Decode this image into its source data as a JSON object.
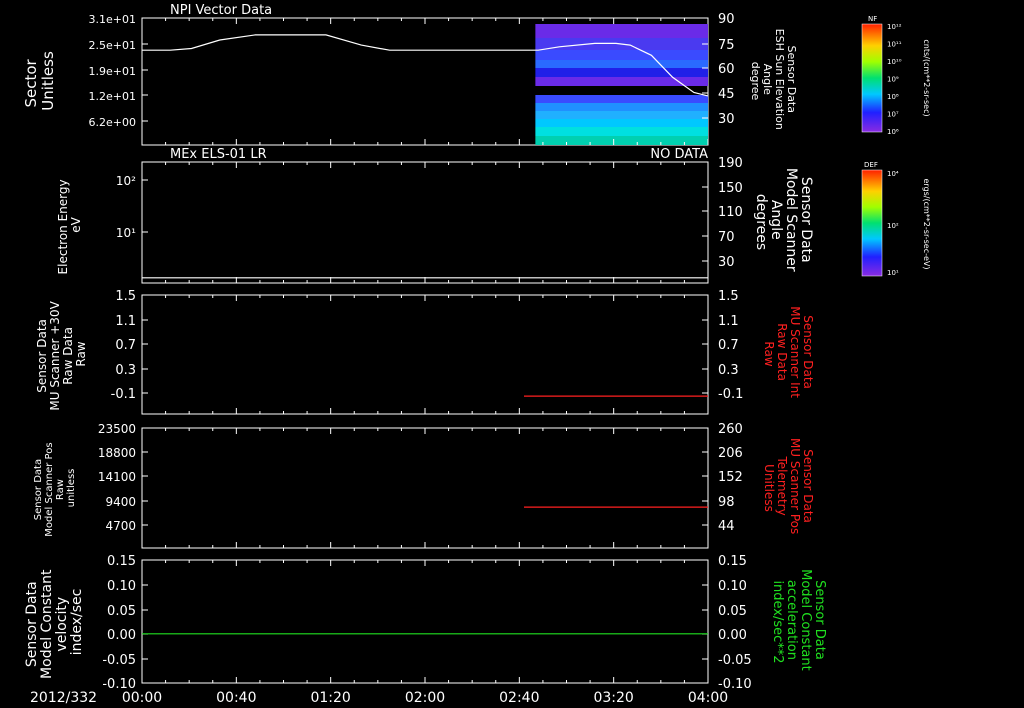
{
  "colors": {
    "background": "#000000",
    "axis": "#ffffff",
    "red": "#ff2020",
    "green": "#20e020"
  },
  "date_label": "2012/332",
  "time_ticks": [
    "00:00",
    "00:40",
    "01:20",
    "02:00",
    "02:40",
    "03:20",
    "04:00"
  ],
  "panel1": {
    "title": "NPI Vector Data",
    "left_label": [
      "Sector",
      "Unitless"
    ],
    "left_ticks": [
      "3.1e+01",
      "2.5e+01",
      "1.9e+01",
      "1.2e+01",
      "6.2e+00"
    ],
    "right_label": [
      "Sensor Data",
      "ESH Sun Elevation",
      "Angle",
      "degree"
    ],
    "right_ticks": [
      "90",
      "75",
      "60",
      "45",
      "30"
    ],
    "colorbar_title": "NF",
    "colorbar_units": "cnts/(cm**2-sr-sec)",
    "colorbar_ticks": [
      "10¹²",
      "10¹¹",
      "10¹⁰",
      "10⁹",
      "10⁸",
      "10⁷",
      "10⁶"
    ]
  },
  "panel2": {
    "title": "MEx ELS-01 LR",
    "status": "NO DATA",
    "left_label": [
      "Electron Energy",
      "eV"
    ],
    "left_ticks": [
      "10²",
      "10¹"
    ],
    "right_label": [
      "Sensor Data",
      "Model Scanner",
      "Angle",
      "degrees"
    ],
    "right_ticks": [
      "190",
      "150",
      "110",
      "70",
      "30"
    ],
    "colorbar_title": "DEF",
    "colorbar_units": "ergs/(cm**2-sr-sec-eV)",
    "colorbar_ticks": [
      "10⁴",
      "10²",
      "10¹"
    ]
  },
  "panel3": {
    "left_label": [
      "Sensor Data",
      "MU Scanner +30V",
      "Raw Data",
      "Raw"
    ],
    "left_ticks": [
      "1.5",
      "1.1",
      "0.7",
      "0.3",
      "-0.1"
    ],
    "right_label": [
      "Sensor Data",
      "MU Scanner Int",
      "Raw Data",
      "Raw"
    ],
    "right_ticks": [
      "1.5",
      "1.1",
      "0.7",
      "0.3",
      "-0.1"
    ]
  },
  "panel4": {
    "left_label": [
      "Sensor Data",
      "Model Scanner Pos",
      "Raw",
      "unitless"
    ],
    "left_ticks": [
      "23500",
      "18800",
      "14100",
      "9400",
      "4700"
    ],
    "right_label": [
      "Sensor Data",
      "MU Scanner Pos",
      "Telemetry",
      "Unitless"
    ],
    "right_ticks": [
      "260",
      "206",
      "152",
      "98",
      "44"
    ]
  },
  "panel5": {
    "left_label": [
      "Sensor Data",
      "Model Constant",
      "velocity",
      "index/sec"
    ],
    "left_ticks": [
      "0.15",
      "0.10",
      "0.05",
      "0.00",
      "-0.05",
      "-0.10"
    ],
    "right_label": [
      "Sensor Data",
      "Model Constant",
      "acceleration",
      "index/sec**2"
    ],
    "right_ticks": [
      "0.15",
      "0.10",
      "0.05",
      "0.00",
      "-0.05",
      "-0.10"
    ]
  },
  "chart_data": [
    {
      "type": "line",
      "panel": "panel1",
      "x_unit": "hours",
      "x": [
        0.0,
        0.2,
        0.35,
        0.55,
        0.8,
        1.0,
        1.3,
        1.55,
        1.75,
        2.0,
        2.5,
        2.8,
        2.95,
        3.2,
        3.35,
        3.45,
        3.6,
        3.75,
        3.9,
        4.0
      ],
      "values": [
        71,
        71,
        72,
        77,
        80,
        80,
        80,
        74,
        71,
        71,
        71,
        71,
        73,
        75,
        75,
        74,
        68,
        55,
        46,
        44
      ],
      "ylim": [
        15,
        90
      ],
      "spectrogram_x_range": [
        2.78,
        4.0
      ]
    },
    {
      "type": "line",
      "panel": "panel2",
      "x": [
        0.0,
        4.0
      ],
      "values": [
        13,
        13
      ],
      "ylim": [
        5,
        190
      ]
    },
    {
      "type": "line",
      "panel": "panel3",
      "x": [
        2.7,
        4.0
      ],
      "values": [
        -0.03,
        -0.03
      ],
      "ylim": [
        -0.3,
        1.5
      ]
    },
    {
      "type": "line",
      "panel": "panel4",
      "x": [
        2.7,
        4.0
      ],
      "values": [
        8000,
        8000
      ],
      "ylim": [
        0,
        23500
      ]
    },
    {
      "type": "line",
      "panel": "panel5",
      "x": [
        0.0,
        4.0
      ],
      "values": [
        0.0,
        0.0
      ],
      "ylim": [
        -0.1,
        0.15
      ]
    }
  ]
}
